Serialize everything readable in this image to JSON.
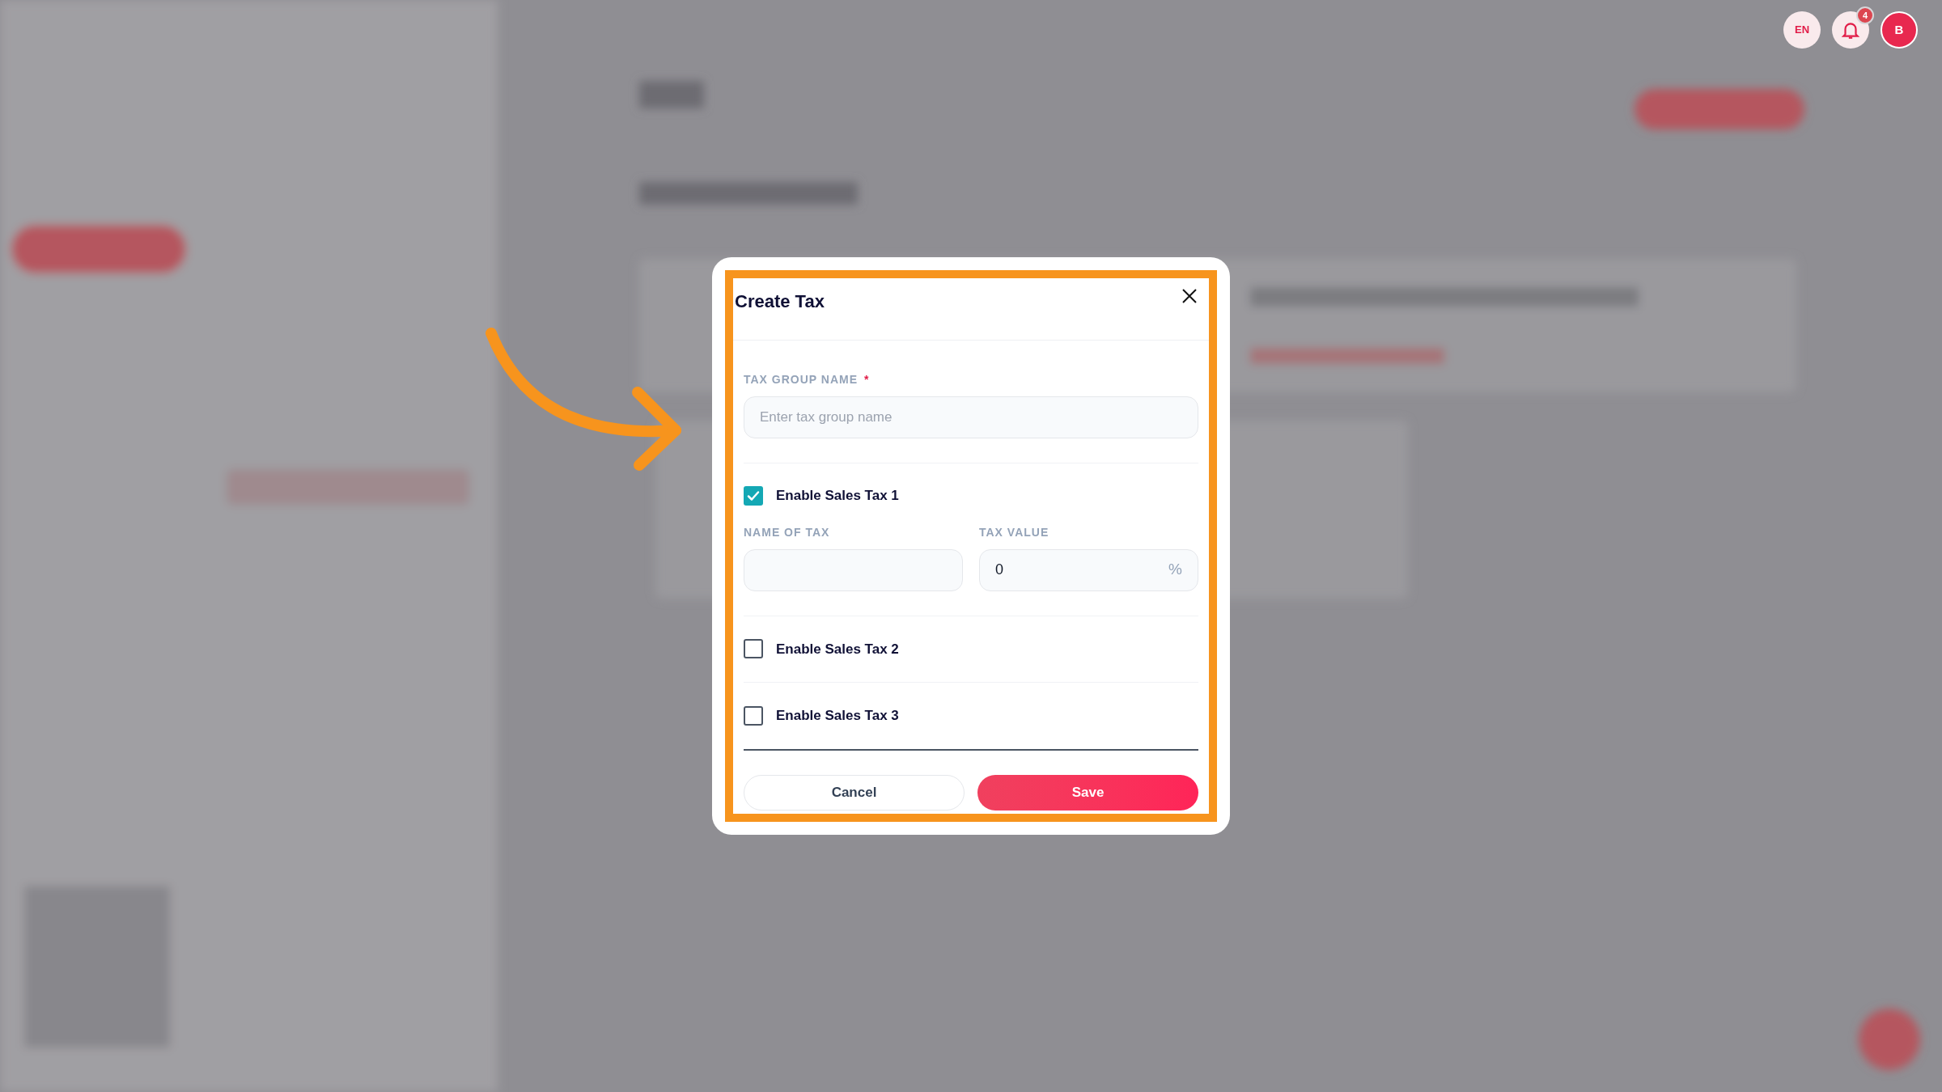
{
  "header": {
    "language": "EN",
    "notifications": "4",
    "avatar": "B"
  },
  "dialog": {
    "title": "Create Tax",
    "group_name": {
      "label": "TAX GROUP NAME",
      "required": "*",
      "placeholder": "Enter tax group name"
    },
    "taxes": [
      {
        "label": "Enable Sales Tax 1",
        "checked": true,
        "name_label": "NAME OF TAX",
        "value_label": "TAX VALUE",
        "value": "0",
        "unit": "%"
      },
      {
        "label": "Enable Sales Tax 2",
        "checked": false
      },
      {
        "label": "Enable Sales Tax 3",
        "checked": false
      }
    ],
    "buttons": {
      "cancel": "Cancel",
      "save": "Save"
    }
  }
}
